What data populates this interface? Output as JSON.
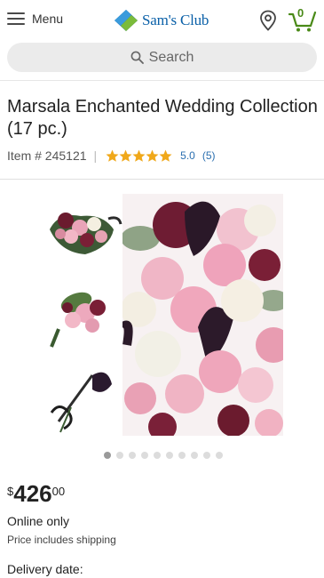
{
  "header": {
    "menu_label": "Menu",
    "logo_text": "Sam's Club",
    "cart_count": "0",
    "brand_color": "#0a60a8",
    "cart_color": "#4a8a18"
  },
  "search": {
    "placeholder": "Search"
  },
  "product": {
    "title": "Marsala Enchanted Wedding Collection (17 pc.)",
    "item_number": "Item # 245121",
    "rating": "5.0",
    "rating_value": 5,
    "review_count": "(5)",
    "price_currency": "$",
    "price_dollars": "426",
    "price_cents": "00",
    "availability": "Online only",
    "shipping_note": "Price includes shipping",
    "delivery_label": "Delivery date:"
  },
  "gallery": {
    "image_count": 10,
    "active_index": 0
  }
}
